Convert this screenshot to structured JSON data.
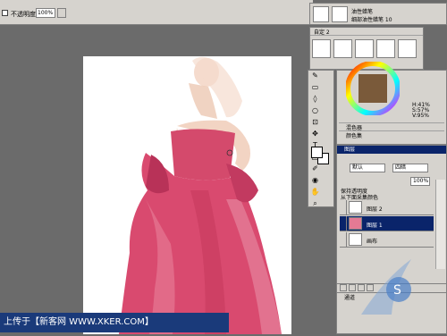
{
  "option_bar": {
    "opacity_label": "不透明度",
    "opacity_value": "100%"
  },
  "brush_header": {
    "line1": "油性蜡笔",
    "line2": "细部油性蜡笔 10"
  },
  "custom_panel": {
    "title": "自定 2"
  },
  "color_panel": {
    "hsv": [
      "H:41%",
      "S:57%",
      "V:95%"
    ],
    "mixer_label": "混色器",
    "swatch_label": "颜色集"
  },
  "layers_panel": {
    "title": "图层",
    "blend_mode": "默认",
    "composite": "四暗",
    "opacity": "100%",
    "preserve_transparency": "保持透明度",
    "pick_below": "从下面采集颜色",
    "layers": [
      {
        "name": "图层 2",
        "active": false
      },
      {
        "name": "图层 1",
        "active": true
      },
      {
        "name": "画布",
        "active": false
      }
    ],
    "channel_label": "通道"
  },
  "caption": {
    "text": "上传于【新客网 WWW.XKER.COM】"
  },
  "colors": {
    "dress": "#d94a6f",
    "title_bar": "#0a246a",
    "caption_bg": "#1a3a7a",
    "chrome": "#d6d3ce"
  }
}
